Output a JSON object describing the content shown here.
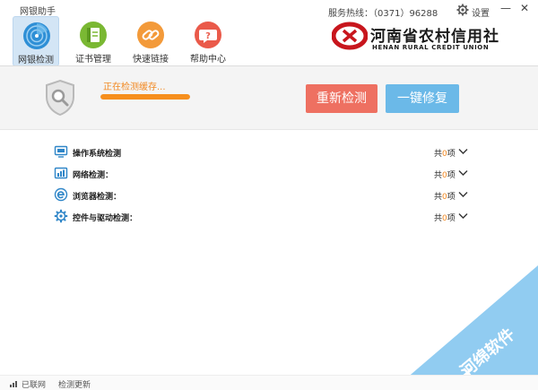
{
  "app": {
    "title": "网银助手"
  },
  "header": {
    "hotline": "服务热线：（0371）96288",
    "settings_label": "设置"
  },
  "toolbar": {
    "tools": [
      {
        "label": "网银检测",
        "icon": "radar-icon"
      },
      {
        "label": "证书管理",
        "icon": "certificate-book-icon"
      },
      {
        "label": "快速链接",
        "icon": "link-icon"
      },
      {
        "label": "帮助中心",
        "icon": "help-icon"
      }
    ]
  },
  "logo": {
    "name_cn": "河南省农村信用社",
    "name_en": "HENAN RURAL CREDIT UNION"
  },
  "status": {
    "text": "正在检测缓存...",
    "progress_percent": 100
  },
  "actions": {
    "recheck": "重新检测",
    "fix": "一键修复"
  },
  "checks": [
    {
      "name": "操作系统检测",
      "prefix": "共",
      "count": "0",
      "suffix": "项",
      "icon": "monitor-icon"
    },
    {
      "name": "网络检测：",
      "prefix": "共",
      "count": "0",
      "suffix": "项",
      "icon": "network-chart-icon"
    },
    {
      "name": "浏览器检测：",
      "prefix": "共",
      "count": "0",
      "suffix": "项",
      "icon": "browser-e-icon"
    },
    {
      "name": "控件与驱动检测：",
      "prefix": "共",
      "count": "0",
      "suffix": "项",
      "icon": "gear-icon"
    }
  ],
  "statusbar": {
    "network": "已联网",
    "update": "检测更新"
  },
  "watermark": {
    "text": "河绵软件"
  },
  "colors": {
    "accent_orange": "#f68f1d",
    "recheck_red": "#ee7061",
    "fix_blue": "#6bb9e8",
    "brand_red": "#c8161d"
  }
}
